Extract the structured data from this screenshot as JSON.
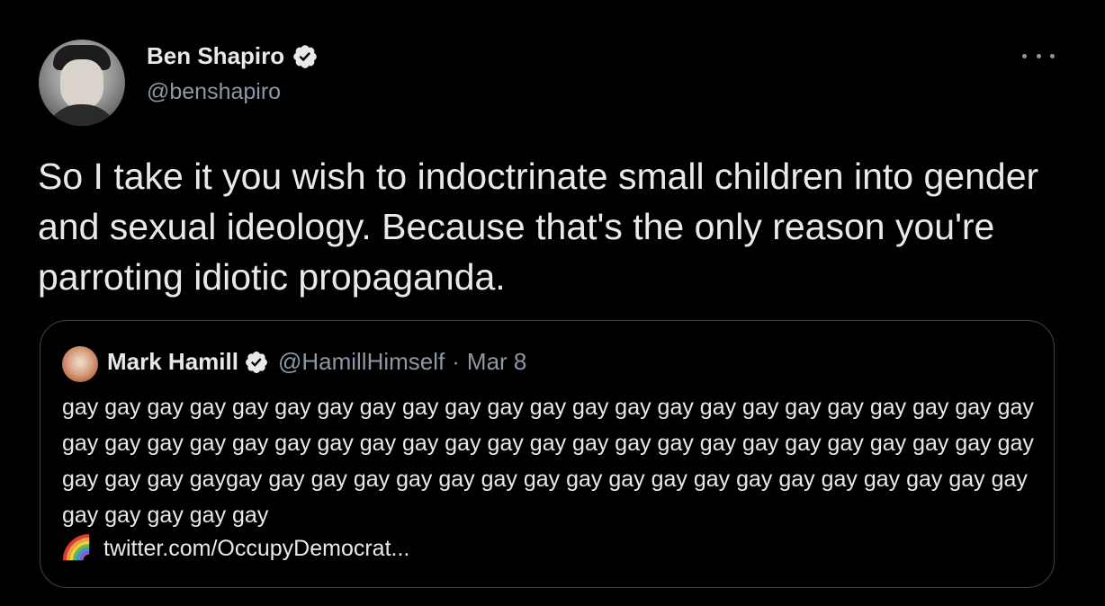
{
  "tweet": {
    "author": {
      "name": "Ben Shapiro",
      "handle": "@benshapiro",
      "verified_icon": "verified-badge-icon"
    },
    "more_icon": "more-options-icon",
    "text": "So I take it you wish to indoctrinate small children into gender and sexual ideology. Because that's the only reason you're parroting idiotic propaganda."
  },
  "quote": {
    "author": {
      "name": "Mark Hamill",
      "handle": "@HamillHimself",
      "verified_icon": "verified-badge-icon"
    },
    "separator": "·",
    "date": "Mar 8",
    "body": "gay gay gay gay gay gay gay gay gay gay gay gay gay gay gay gay gay gay gay gay gay gay gay gay gay gay gay gay gay gay gay gay gay gay gay gay gay gay gay gay gay gay gay gay gay gay gay gay gay gaygay gay gay gay gay gay gay gay gay gay gay gay gay gay gay gay gay gay gay gay gay gay gay gay",
    "link_icon": "rainbow-icon",
    "link": "twitter.com/OccupyDemocrat..."
  },
  "colors": {
    "background": "#000000",
    "text": "#e7e9ea",
    "secondary": "#8b98a5",
    "border": "#3e4144"
  }
}
